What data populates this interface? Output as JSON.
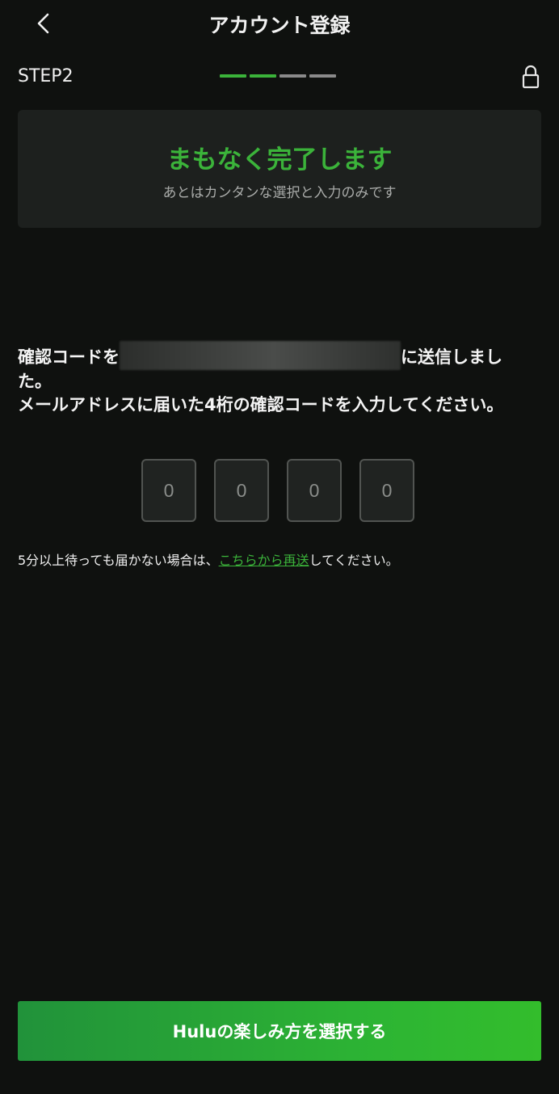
{
  "header": {
    "title": "アカウント登録",
    "back_icon": "chevron-left-icon"
  },
  "step": {
    "label": "STEP2",
    "total_steps": 4,
    "completed_steps": 2,
    "active_color": "#3bb33a",
    "inactive_color": "#8a8a8a",
    "lock_icon": "lock-icon"
  },
  "banner": {
    "title": "まもなく完了します",
    "subtitle": "あとはカンタンな選択と入力のみです"
  },
  "message": {
    "prefix": "確認コードを",
    "suffix": "に送信しました。",
    "line2": "メールアドレスに届いた4桁の確認コードを入力してください。"
  },
  "code_inputs": [
    {
      "placeholder": "0"
    },
    {
      "placeholder": "0"
    },
    {
      "placeholder": "0"
    },
    {
      "placeholder": "0"
    }
  ],
  "resend": {
    "prefix": "5分以上待っても届かない場合は、",
    "link": "こちらから再送",
    "suffix": "してください。"
  },
  "cta": {
    "label": "Huluの楽しみ方を選択する"
  },
  "colors": {
    "accent": "#3bb33a",
    "background": "#0f110f"
  }
}
